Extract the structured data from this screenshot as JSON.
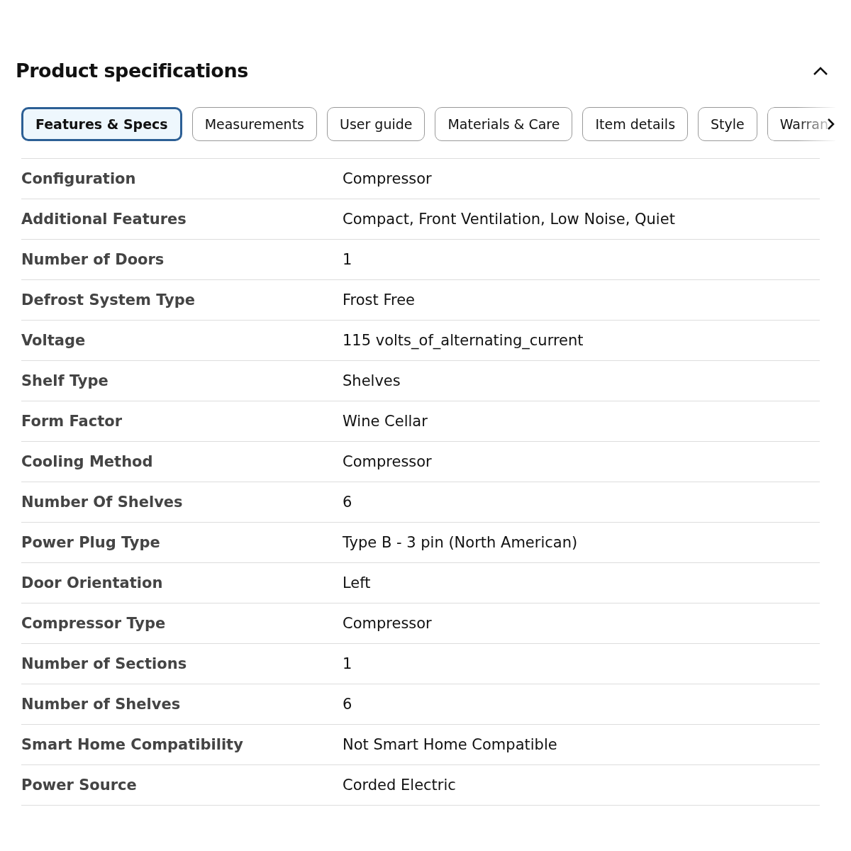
{
  "title": "Product specifications",
  "collapse": {
    "expanded": true
  },
  "tabs": [
    {
      "label": "Features & Specs",
      "selected": true
    },
    {
      "label": "Measurements",
      "selected": false
    },
    {
      "label": "User guide",
      "selected": false
    },
    {
      "label": "Materials & Care",
      "selected": false
    },
    {
      "label": "Item details",
      "selected": false
    },
    {
      "label": "Style",
      "selected": false
    },
    {
      "label": "Warran",
      "selected": false
    }
  ],
  "specs": [
    {
      "label": "Configuration",
      "value": "Compressor"
    },
    {
      "label": "Additional Features",
      "value": "Compact, Front Ventilation, Low Noise, Quiet"
    },
    {
      "label": "Number of Doors",
      "value": "1"
    },
    {
      "label": "Defrost System Type",
      "value": "Frost Free"
    },
    {
      "label": "Voltage",
      "value": "115 volts_of_alternating_current"
    },
    {
      "label": "Shelf Type",
      "value": "Shelves"
    },
    {
      "label": "Form Factor",
      "value": "Wine Cellar"
    },
    {
      "label": "Cooling Method",
      "value": "Compressor"
    },
    {
      "label": "Number Of Shelves",
      "value": "6"
    },
    {
      "label": "Power Plug Type",
      "value": "Type B - 3 pin (North American)"
    },
    {
      "label": "Door Orientation",
      "value": "Left"
    },
    {
      "label": "Compressor Type",
      "value": "Compressor"
    },
    {
      "label": "Number of Sections",
      "value": "1"
    },
    {
      "label": "Number of Shelves",
      "value": "6"
    },
    {
      "label": "Smart Home Compatibility",
      "value": "Not Smart Home Compatible"
    },
    {
      "label": "Power Source",
      "value": "Corded Electric"
    }
  ]
}
